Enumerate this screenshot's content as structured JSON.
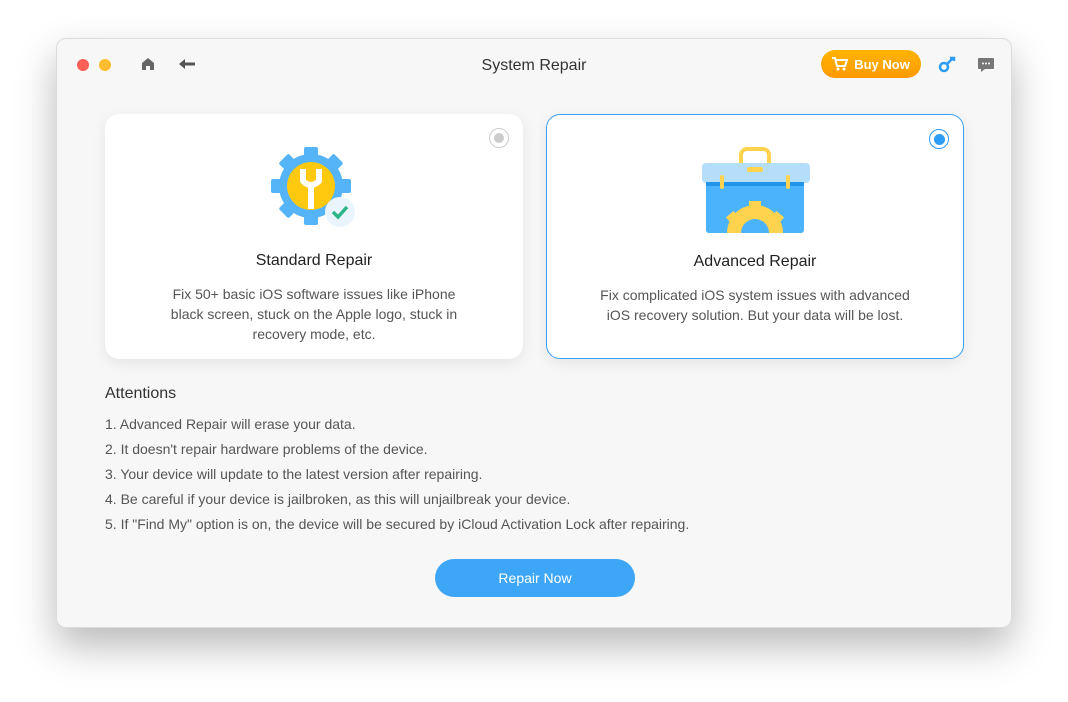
{
  "window": {
    "title": "System Repair"
  },
  "toolbar": {
    "buy_label": "Buy Now"
  },
  "colors": {
    "accent": "#3ea6f7",
    "buy": "#ffa500",
    "close": "#fe5f57",
    "minimize": "#febc2e"
  },
  "cards": [
    {
      "title": "Standard Repair",
      "description": "Fix 50+ basic iOS software issues like iPhone black screen, stuck on the Apple logo, stuck in recovery mode, etc.",
      "selected": false,
      "icon": "gear-wrench-check-icon"
    },
    {
      "title": "Advanced Repair",
      "description": "Fix complicated iOS system issues with advanced iOS recovery solution. But your data will be lost.",
      "selected": true,
      "icon": "toolbox-gear-icon"
    }
  ],
  "attentions": {
    "heading": "Attentions",
    "items": [
      "1. Advanced Repair will erase your data.",
      "2. It doesn't repair hardware problems of the device.",
      "3. Your device will update to the latest version after repairing.",
      "4. Be careful if your device is jailbroken, as this will unjailbreak your device.",
      "5. If \"Find My\" option is on, the device will be secured by iCloud Activation Lock after repairing."
    ]
  },
  "repair_button": "Repair Now"
}
